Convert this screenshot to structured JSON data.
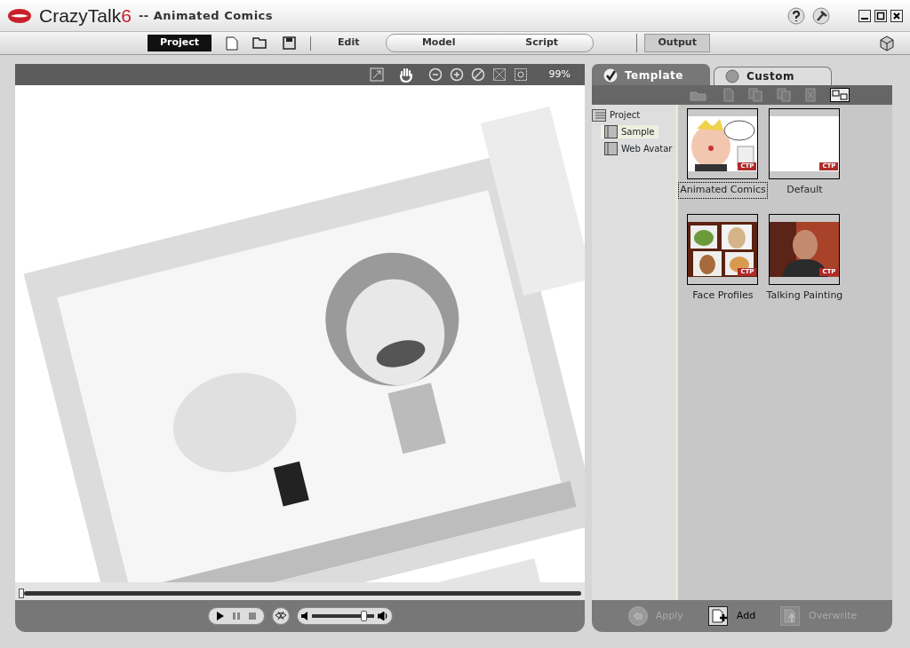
{
  "window": {
    "logo_text": "CrazyTalk",
    "logo_version": "6",
    "title": "-- Animated Comics"
  },
  "main_tabs": [
    {
      "label": "Project",
      "selected": true
    },
    {
      "label": "Edit",
      "selected": false
    },
    {
      "label": "Model",
      "selected": false
    },
    {
      "label": "Script",
      "selected": false
    },
    {
      "label": "Output",
      "selected": false
    }
  ],
  "viewer": {
    "zoom": "99%",
    "timeline": {
      "level": 0
    },
    "volume": {
      "level": 0.88
    }
  },
  "panel_tabs": [
    {
      "label": "Template",
      "selected": true
    },
    {
      "label": "Custom",
      "selected": false
    }
  ],
  "tree": {
    "label": "Project",
    "children": [
      {
        "label": "Sample",
        "selected": true
      },
      {
        "label": "Web Avatar",
        "selected": false
      }
    ]
  },
  "templates": [
    {
      "label": "Animated Comics",
      "badge": "CTP",
      "kind": "comic",
      "selected": true
    },
    {
      "label": "Default",
      "badge": "CTP",
      "kind": "blank",
      "selected": false
    },
    {
      "label": "Face Profiles",
      "badge": "CTP",
      "kind": "collage",
      "selected": false
    },
    {
      "label": "Talking Painting",
      "badge": "CTP",
      "kind": "portrait",
      "selected": false
    }
  ],
  "actions": [
    {
      "label": "Apply",
      "disabled": true
    },
    {
      "label": "Add",
      "disabled": false
    },
    {
      "label": "Overwrite",
      "disabled": true
    }
  ]
}
